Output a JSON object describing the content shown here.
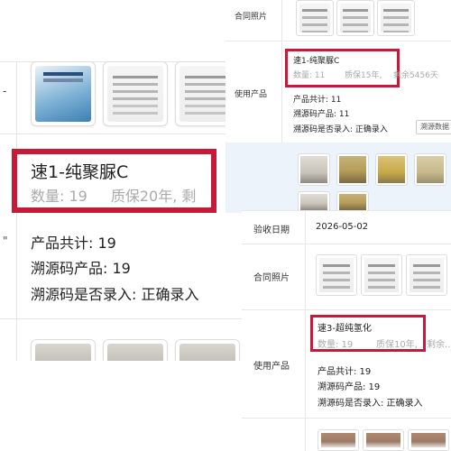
{
  "left_panel": {
    "row_marker_top": "-",
    "row_marker_mid": "\"",
    "product_name": "速1-纯聚脲C",
    "product_qty": "数量: 19",
    "product_warranty": "质保20年, 剩",
    "total_products": "产品共计: 19",
    "trace_products": "溯源码产品: 19",
    "trace_entered": "溯源码是否录入: 正确录入"
  },
  "top_right_panel": {
    "contract_label": "合同照片",
    "product_label": "使用产品",
    "product_name": "速1-纯聚脲C",
    "product_qty": "数量: 11",
    "product_warranty": "质保15年,",
    "product_remaining": "剩余5456天",
    "total_products": "产品共计: 11",
    "trace_products": "溯源码产品: 11",
    "trace_entered": "溯源码是否录入: 正确录入",
    "trace_button": "溯源数据"
  },
  "bottom_right_panel": {
    "acceptance_label": "验收日期",
    "acceptance_date": "2026-05-02",
    "contract_label": "合同照片",
    "product_label": "使用产品",
    "product_name": "速3-超纯氢化",
    "product_qty": "数量: 19",
    "product_warranty": "质保10年,",
    "product_remaining": "剩余...",
    "total_products": "产品共计: 19",
    "trace_products": "溯源码产品: 19",
    "trace_entered": "溯源码是否录入: 正确录入"
  },
  "colors": {
    "highlight": "#c8193a",
    "selected_row": "#ecf3fb",
    "muted_text": "#aaaaaa"
  }
}
